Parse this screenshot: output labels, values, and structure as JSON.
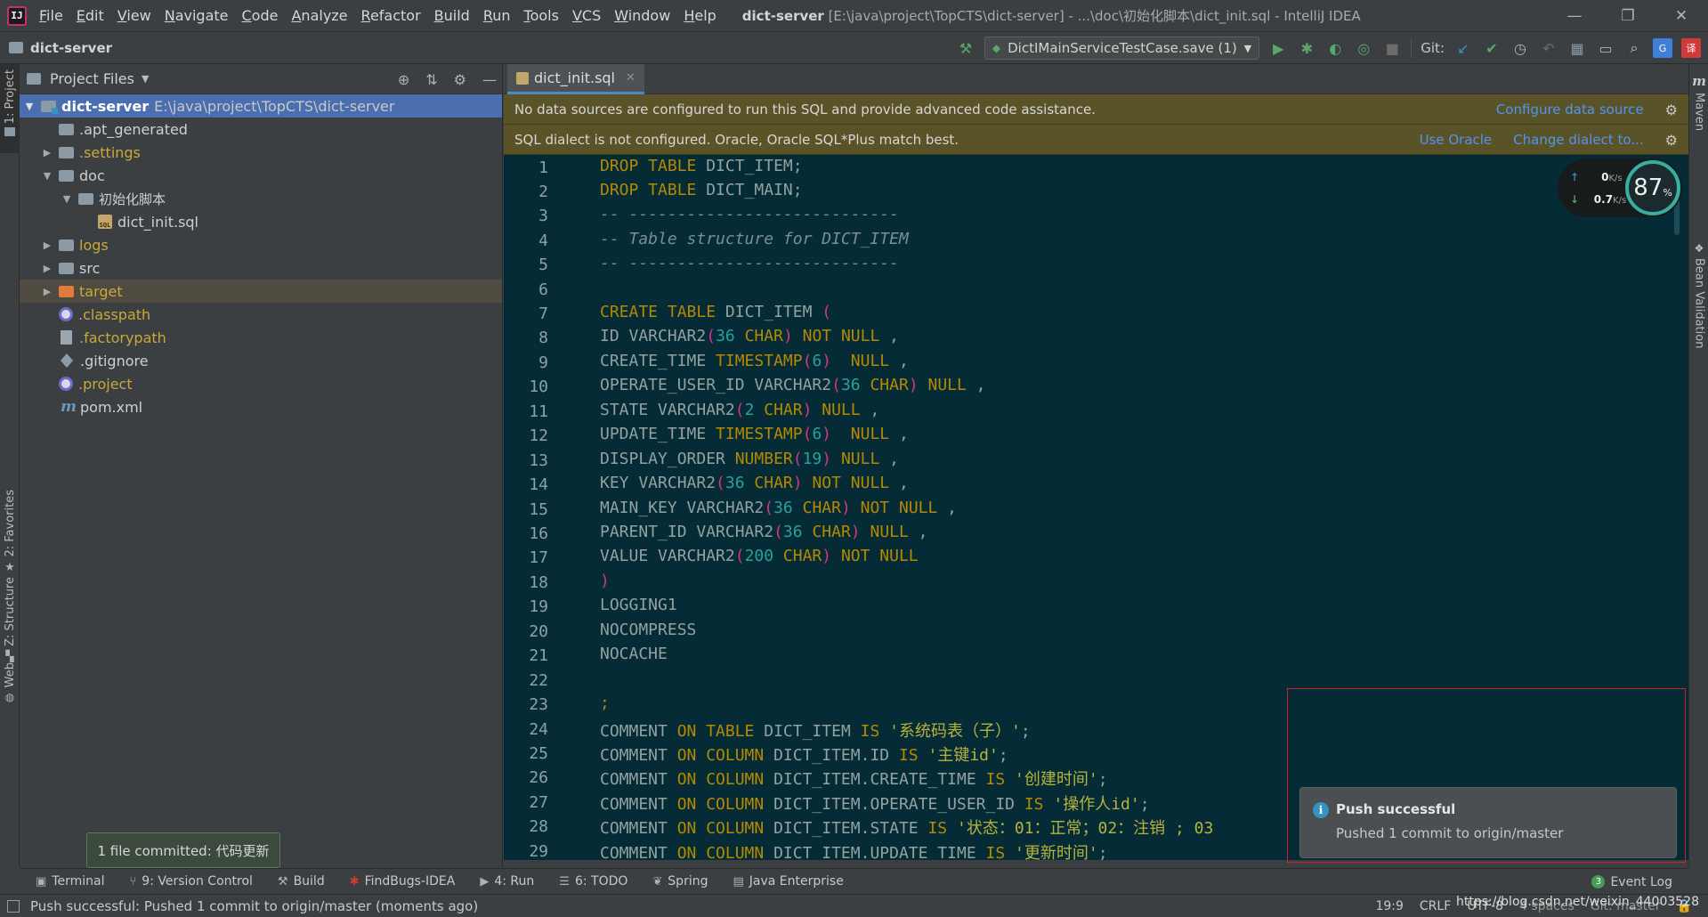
{
  "window": {
    "menus": [
      "File",
      "Edit",
      "View",
      "Navigate",
      "Code",
      "Analyze",
      "Refactor",
      "Build",
      "Run",
      "Tools",
      "VCS",
      "Window",
      "Help"
    ],
    "title_project": "dict-server",
    "title_rest": " [E:\\java\\project\\TopCTS\\dict-server] - ...\\doc\\初始化脚本\\dict_init.sql - IntelliJ IDEA",
    "controls": {
      "minimize": "—",
      "restore": "❐",
      "close": "✕"
    }
  },
  "navbar": {
    "project": "dict-server",
    "run_config": "DictIMainServiceTestCase.save (1)",
    "git_label": "Git:"
  },
  "left_strip": {
    "project_tab": "1: Project",
    "favorites_tab": "2: Favorites",
    "structure_tab": "Z: Structure",
    "web_tab": "Web"
  },
  "right_strip": {
    "maven_tab": "Maven",
    "bean_tab": "Bean Validation"
  },
  "project_panel": {
    "title": "Project Files",
    "tree": [
      {
        "label": "dict-server",
        "path": "E:\\java\\project\\TopCTS\\dict-server"
      },
      {
        "label": ".apt_generated"
      },
      {
        "label": ".settings"
      },
      {
        "label": "doc"
      },
      {
        "label": "初始化脚本"
      },
      {
        "label": "dict_init.sql"
      },
      {
        "label": "logs"
      },
      {
        "label": "src"
      },
      {
        "label": "target"
      },
      {
        "label": ".classpath"
      },
      {
        "label": ".factorypath"
      },
      {
        "label": ".gitignore"
      },
      {
        "label": ".project"
      },
      {
        "label": "pom.xml"
      }
    ]
  },
  "editor": {
    "tab_label": "dict_init.sql",
    "banner1": {
      "message": "No data sources are configured to run this SQL and provide advanced code assistance.",
      "action": "Configure data source"
    },
    "banner2": {
      "message": "SQL dialect is not configured. Oracle, Oracle SQL*Plus match best.",
      "action1": "Use Oracle",
      "action2": "Change dialect to..."
    },
    "line_numbers": [
      "1",
      "2",
      "3",
      "4",
      "5",
      "6",
      "7",
      "8",
      "9",
      "10",
      "11",
      "12",
      "13",
      "14",
      "15",
      "16",
      "17",
      "18",
      "19",
      "20",
      "21",
      "22",
      "23",
      "24",
      "25",
      "26",
      "27",
      "28",
      "29"
    ]
  },
  "network_widget": {
    "up": "0",
    "down": "0.7",
    "unit": "K/s",
    "percent": "87",
    "percent_sign": "%"
  },
  "notification": {
    "title": "Push successful",
    "body": "Pushed 1 commit to origin/master"
  },
  "commit_tooltip": "1 file committed: 代码更新",
  "bottom_tools": [
    {
      "label": "Terminal"
    },
    {
      "label": "9: Version Control"
    },
    {
      "label": "Build"
    },
    {
      "label": "FindBugs-IDEA"
    },
    {
      "label": "4: Run"
    },
    {
      "label": "6: TODO"
    },
    {
      "label": "Spring"
    },
    {
      "label": "Java Enterprise"
    }
  ],
  "event_log": {
    "count": "3",
    "label": "Event Log"
  },
  "status": {
    "message": "Push successful: Pushed 1 commit to origin/master (moments ago)",
    "position": "19:9",
    "line_sep": "CRLF",
    "encoding": "UTF-8",
    "indent": "4 spaces",
    "branch": "Git: master",
    "watermark": "https://blog.csdn.net/weixin_44003528"
  },
  "colors": {
    "editor_bg": "#042b36",
    "keyword": "#b58900",
    "number": "#2aa198",
    "banner_bg": "#5a5328",
    "selection": "#4b6eaf",
    "link": "#5394ec"
  }
}
